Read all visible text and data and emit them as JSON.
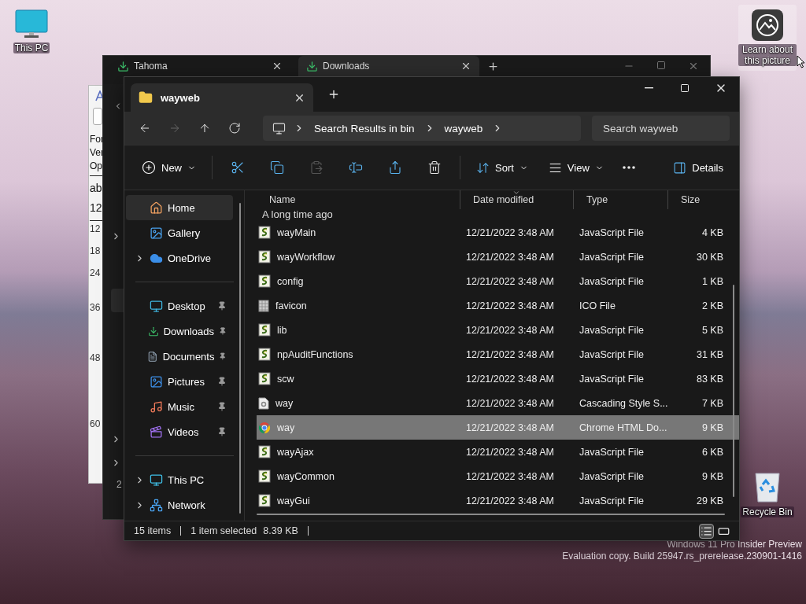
{
  "desktop_icons": [
    {
      "kind": "computer",
      "label": "This PC"
    },
    {
      "kind": "picture_info",
      "label": "Learn about this picture"
    },
    {
      "kind": "recycle",
      "label": "Recycle Bin"
    }
  ],
  "os_notice": [
    "Windows 11 Pro Insider Preview",
    "Evaluation copy. Build 25947.rs_prerelease.230901-1416"
  ],
  "font_viewer": {
    "menu_lines": [
      "For",
      "Ver",
      "Op"
    ],
    "sample": [
      "ab",
      "12"
    ],
    "sizes": [
      "12",
      "18",
      "24",
      "36",
      "48",
      "60"
    ]
  },
  "back_explorer": {
    "tabs": [
      {
        "label": "Tahoma",
        "selected": false
      },
      {
        "label": "Downloads",
        "selected": true
      }
    ],
    "sidebar_items": [
      {
        "expandable": true,
        "selected": false
      },
      {
        "expandable": false,
        "selected": true
      },
      {
        "expandable": true,
        "selected": false
      },
      {
        "expandable": true,
        "selected": false
      }
    ],
    "status": "2"
  },
  "explorer": {
    "tabs": [
      {
        "label": "wayweb",
        "selected": true
      }
    ],
    "nav_buttons": [
      {
        "kind": "back",
        "disabled": false
      },
      {
        "kind": "forward",
        "disabled": true
      },
      {
        "kind": "up",
        "disabled": false
      },
      {
        "kind": "refresh",
        "disabled": false
      }
    ],
    "breadcrumb": [
      "Search Results in bin",
      "wayweb"
    ],
    "search": {
      "placeholder": "Search wayweb"
    },
    "new_button": {
      "label": "New"
    },
    "edit_tools": [
      {
        "kind": "cut",
        "disabled": false
      },
      {
        "kind": "copy",
        "disabled": false
      },
      {
        "kind": "paste",
        "disabled": true
      },
      {
        "kind": "rename",
        "disabled": false
      },
      {
        "kind": "share",
        "disabled": false
      },
      {
        "kind": "delete",
        "disabled": false
      }
    ],
    "sort_button": {
      "label": "Sort"
    },
    "view_button": {
      "label": "View"
    },
    "details_button": {
      "label": "Details"
    },
    "sidebar_groups": [
      {
        "items": [
          {
            "kind": "home",
            "label": "Home",
            "selected": true,
            "expandable": false,
            "pinned": false
          },
          {
            "kind": "gallery",
            "label": "Gallery",
            "selected": false,
            "expandable": false,
            "pinned": false
          },
          {
            "kind": "cloud",
            "label": "OneDrive",
            "selected": false,
            "expandable": true,
            "pinned": false
          }
        ]
      },
      {
        "items": [
          {
            "kind": "desktop",
            "label": "Desktop",
            "selected": false,
            "expandable": false,
            "pinned": true
          },
          {
            "kind": "downloads",
            "label": "Downloads",
            "selected": false,
            "expandable": false,
            "pinned": true
          },
          {
            "kind": "documents",
            "label": "Documents",
            "selected": false,
            "expandable": false,
            "pinned": true
          },
          {
            "kind": "pictures",
            "label": "Pictures",
            "selected": false,
            "expandable": false,
            "pinned": true
          },
          {
            "kind": "music",
            "label": "Music",
            "selected": false,
            "expandable": false,
            "pinned": true
          },
          {
            "kind": "videos",
            "label": "Videos",
            "selected": false,
            "expandable": false,
            "pinned": true
          }
        ]
      },
      {
        "items": [
          {
            "kind": "computer",
            "label": "This PC",
            "selected": false,
            "expandable": true,
            "pinned": false
          },
          {
            "kind": "network",
            "label": "Network",
            "selected": false,
            "expandable": true,
            "pinned": false
          }
        ]
      }
    ],
    "columns": [
      {
        "label": "Name",
        "sorted": false
      },
      {
        "label": "Date modified",
        "sorted": true
      },
      {
        "label": "Type",
        "sorted": false
      },
      {
        "label": "Size",
        "sorted": false
      }
    ],
    "group_header": "A long time ago",
    "rows": [
      {
        "kind": "script",
        "name": "wayMain",
        "date": "12/21/2022 3:48 AM",
        "type": "JavaScript File",
        "size": "4 KB",
        "selected": false
      },
      {
        "kind": "script",
        "name": "wayWorkflow",
        "date": "12/21/2022 3:48 AM",
        "type": "JavaScript File",
        "size": "30 KB",
        "selected": false
      },
      {
        "kind": "script",
        "name": "config",
        "date": "12/21/2022 3:48 AM",
        "type": "JavaScript File",
        "size": "1 KB",
        "selected": false
      },
      {
        "kind": "icon_file",
        "name": "favicon",
        "date": "12/21/2022 3:48 AM",
        "type": "ICO File",
        "size": "2 KB",
        "selected": false
      },
      {
        "kind": "script",
        "name": "lib",
        "date": "12/21/2022 3:48 AM",
        "type": "JavaScript File",
        "size": "5 KB",
        "selected": false
      },
      {
        "kind": "script",
        "name": "npAuditFunctions",
        "date": "12/21/2022 3:48 AM",
        "type": "JavaScript File",
        "size": "31 KB",
        "selected": false
      },
      {
        "kind": "script",
        "name": "scw",
        "date": "12/21/2022 3:48 AM",
        "type": "JavaScript File",
        "size": "83 KB",
        "selected": false
      },
      {
        "kind": "stylesheet",
        "name": "way",
        "date": "12/21/2022 3:48 AM",
        "type": "Cascading Style S...",
        "size": "7 KB",
        "selected": false
      },
      {
        "kind": "browser",
        "name": "way",
        "date": "12/21/2022 3:48 AM",
        "type": "Chrome HTML Do...",
        "size": "9 KB",
        "selected": true
      },
      {
        "kind": "script",
        "name": "wayAjax",
        "date": "12/21/2022 3:48 AM",
        "type": "JavaScript File",
        "size": "6 KB",
        "selected": false
      },
      {
        "kind": "script",
        "name": "wayCommon",
        "date": "12/21/2022 3:48 AM",
        "type": "JavaScript File",
        "size": "9 KB",
        "selected": false
      },
      {
        "kind": "script",
        "name": "wayGui",
        "date": "12/21/2022 3:48 AM",
        "type": "JavaScript File",
        "size": "29 KB",
        "selected": false
      }
    ],
    "status": {
      "count": "15 items",
      "selection": "1 item selected",
      "selection_size": "8.39 KB"
    },
    "view_toggles": [
      {
        "kind": "details",
        "selected": true
      },
      {
        "kind": "tiles",
        "selected": false
      }
    ]
  }
}
